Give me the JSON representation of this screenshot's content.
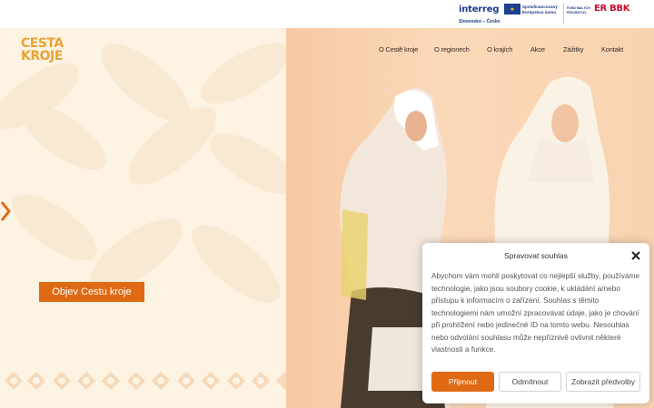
{
  "topbar": {
    "interreg": "interreg",
    "region": "Slovensko – Česko",
    "eu_text": "Spolufinancovaný Európskou úniou",
    "fund_text": "FOND MALÝCH PROJEKTOV",
    "erbbk": "ER BBK"
  },
  "logo": {
    "line1": "CESTA",
    "line2": "KROJE"
  },
  "nav": {
    "items": [
      "O Cestě kroje",
      "O regionech",
      "O krajích",
      "Akce",
      "Zážitky",
      "Kontakt"
    ]
  },
  "hero": {
    "cta_label": "Objev Cestu kroje"
  },
  "consent": {
    "title": "Spravovat souhlas",
    "body": "Abychom vám mohli poskytovat co nejlepší služby, používáme technologie, jako jsou soubory cookie, k ukládání a/nebo přístupu k informacím o zařízení. Souhlas s těmito technologiemi nám umožní zpracovávat údaje, jako je chování při prohlížení nebo jedinečné ID na tomto webu. Nesouhlas nebo odvolání souhlasu může nepříznivě ovlivnit některé vlastnosti a funkce.",
    "accept": "Přijmout",
    "deny": "Odmítnout",
    "preferences": "Zobrazit předvolby"
  },
  "colors": {
    "accent": "#e06a14",
    "logo": "#e7a335",
    "background": "#fdf3e2",
    "photo_bg": "#f8d3b1"
  },
  "icons": {
    "eu_flag": "eu-flag-icon",
    "close": "close-icon",
    "arrow": "chevron-left-icon"
  }
}
